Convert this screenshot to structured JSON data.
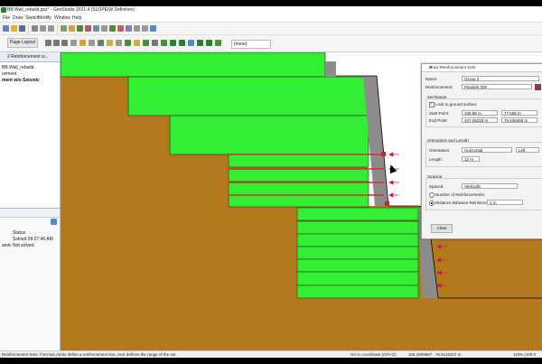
{
  "window": {
    "title": "BB Wall_rebuild.gsz* - GeoStudio 2021.4 (SLOPE/W Definition)"
  },
  "menu": [
    "File",
    "Draw",
    "Sketch",
    "Modify",
    "Window",
    "Help"
  ],
  "toolbar": {
    "page_layout_label": "Page Layout",
    "sorted_dropdown": "(none)"
  },
  "left_panel": {
    "tab_label": "2 Reinforcement w...",
    "tree": [
      "BB Wall_rebuild",
      "",
      "cement",
      "ment w/o Seismic"
    ],
    "props": [
      {
        "label": "",
        "value": "Status"
      },
      {
        "label": "",
        "value": "Solved 09:27:46 AM"
      },
      {
        "label": "amic",
        "value": "Not solved"
      }
    ]
  },
  "dialog": {
    "title": "Draw Reinforcement Sets",
    "name_label": "Name:",
    "name_value": "Group 2",
    "reinforcement_label": "Reinforcement:",
    "reinforcement_value": "Paralink 300",
    "set_range_label": "Set Range",
    "lock_label": "Lock to ground surface",
    "start_label": "Start Point:",
    "start_x": "106.88 m",
    "start_y": "77.558 m",
    "end_label": "End Point:",
    "end_x": "107.25215 m",
    "end_y": "75.636458 m",
    "orientation_section": "Orientation and Length",
    "orientation_label": "Orientation:",
    "orientation_value": "Horizontal",
    "direction_value": "Left",
    "length_label": "Length:",
    "length_value": "12 m",
    "spacing_section": "Spacing",
    "spaced_label": "Spaced:",
    "spaced_value": "Vertically",
    "num_reinf_label": "Number of Reinforcements:",
    "distance_label": "Distance Between Reinforcements:",
    "distance_value": "1 m",
    "clear_label": "Clear"
  },
  "status": {
    "hint": "Reinforcement Sets: First two clicks define a reinforcement line, next defines the range of the set",
    "coords_label": "Go to coordinate (Ctrl+G)",
    "coords_value": "106.2609667 , 76.6116327 m",
    "zoom_value": "118% (100.0"
  },
  "colors": {
    "soil": "#b5791d",
    "block": "#33ee33",
    "facing": "#8c8c8c",
    "reinforcement": "#d32f2f",
    "load_arrow": "#c2185b"
  }
}
